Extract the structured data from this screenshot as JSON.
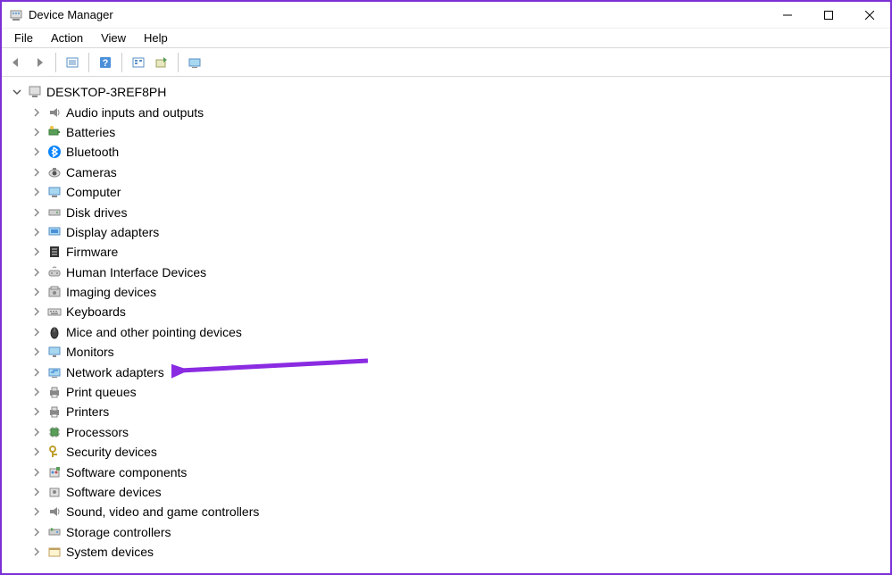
{
  "window": {
    "title": "Device Manager"
  },
  "menubar": {
    "file": "File",
    "action": "Action",
    "view": "View",
    "help": "Help"
  },
  "tree": {
    "root_label": "DESKTOP-3REF8PH",
    "categories": [
      {
        "label": "Audio inputs and outputs",
        "icon": "speaker"
      },
      {
        "label": "Batteries",
        "icon": "battery"
      },
      {
        "label": "Bluetooth",
        "icon": "bluetooth"
      },
      {
        "label": "Cameras",
        "icon": "camera"
      },
      {
        "label": "Computer",
        "icon": "computer"
      },
      {
        "label": "Disk drives",
        "icon": "disk"
      },
      {
        "label": "Display adapters",
        "icon": "display"
      },
      {
        "label": "Firmware",
        "icon": "firmware"
      },
      {
        "label": "Human Interface Devices",
        "icon": "hid"
      },
      {
        "label": "Imaging devices",
        "icon": "imaging"
      },
      {
        "label": "Keyboards",
        "icon": "keyboard"
      },
      {
        "label": "Mice and other pointing devices",
        "icon": "mouse"
      },
      {
        "label": "Monitors",
        "icon": "monitor"
      },
      {
        "label": "Network adapters",
        "icon": "network"
      },
      {
        "label": "Print queues",
        "icon": "printer"
      },
      {
        "label": "Printers",
        "icon": "printer"
      },
      {
        "label": "Processors",
        "icon": "cpu"
      },
      {
        "label": "Security devices",
        "icon": "security"
      },
      {
        "label": "Software components",
        "icon": "software"
      },
      {
        "label": "Software devices",
        "icon": "software2"
      },
      {
        "label": "Sound, video and game controllers",
        "icon": "speaker"
      },
      {
        "label": "Storage controllers",
        "icon": "storage"
      },
      {
        "label": "System devices",
        "icon": "system"
      }
    ]
  },
  "annotation": {
    "arrow_color": "#8a2be2",
    "target": "Network adapters"
  }
}
